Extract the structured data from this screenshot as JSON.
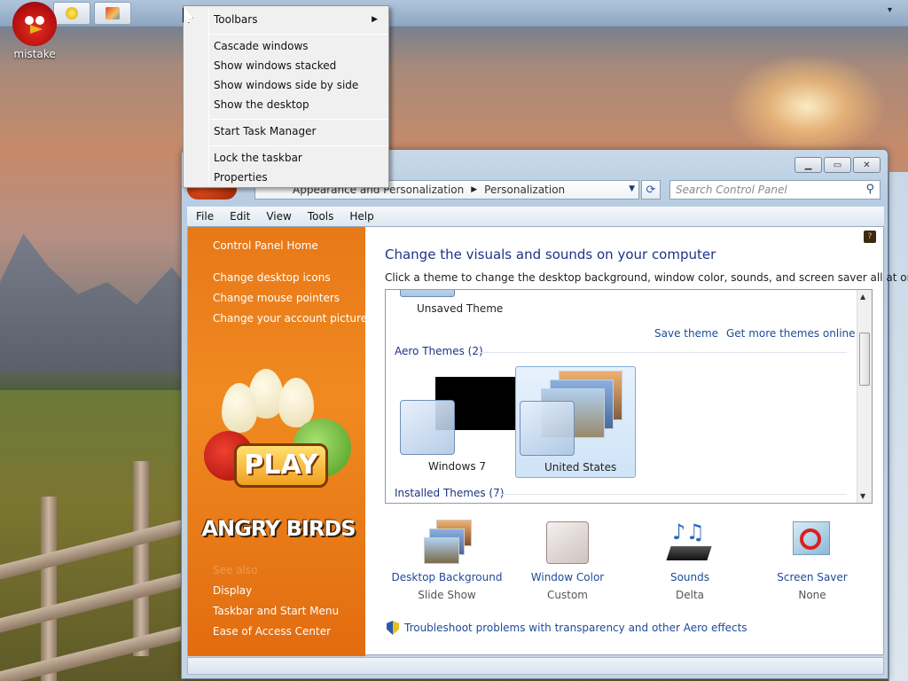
{
  "desktop": {
    "icon_label": "mistake"
  },
  "taskbar": {
    "buttons": [
      "app-button-1",
      "app-button-2"
    ],
    "chevron": "▾"
  },
  "context_menu": {
    "items": [
      {
        "label": "Toolbars",
        "submenu": true
      },
      {
        "label": "Cascade windows"
      },
      {
        "label": "Show windows stacked"
      },
      {
        "label": "Show windows side by side"
      },
      {
        "label": "Show the desktop"
      },
      {
        "label": "Start Task Manager"
      },
      {
        "label": "Lock the taskbar"
      },
      {
        "label": "Properties"
      }
    ]
  },
  "window": {
    "breadcrumb": [
      "Appearance and Personalization",
      "Personalization"
    ],
    "search_placeholder": "Search Control Panel",
    "menu": [
      "File",
      "Edit",
      "View",
      "Tools",
      "Help"
    ],
    "sidebar": {
      "home": "Control Panel Home",
      "links": [
        "Change desktop icons",
        "Change mouse pointers",
        "Change your account picture"
      ],
      "see_also": "See also",
      "see_also_links": [
        "Display",
        "Taskbar and Start Menu",
        "Ease of Access Center"
      ],
      "art_button": "PLAY",
      "art_title": "ANGRY BIRDS"
    },
    "main": {
      "title": "Change the visuals and sounds on your computer",
      "subtitle": "Click a theme to change the desktop background, window color, sounds, and screen saver all at once.",
      "unsaved_theme": "Unsaved Theme",
      "save_theme": "Save theme",
      "get_more": "Get more themes online",
      "aero_group": "Aero Themes (2)",
      "themes": [
        {
          "name": "Windows 7",
          "selected": false
        },
        {
          "name": "United States",
          "selected": true
        }
      ],
      "installed_group": "Installed Themes (7)",
      "tiles": [
        {
          "name": "Desktop Background",
          "value": "Slide Show"
        },
        {
          "name": "Window Color",
          "value": "Custom"
        },
        {
          "name": "Sounds",
          "value": "Delta"
        },
        {
          "name": "Screen Saver",
          "value": "None"
        }
      ],
      "troubleshoot": "Troubleshoot problems with transparency and other Aero effects"
    }
  },
  "colors": {
    "sidebar": "#f08a20",
    "link": "#1e4a9a",
    "heading": "#1e3287",
    "selection": "#cfe3f7"
  }
}
